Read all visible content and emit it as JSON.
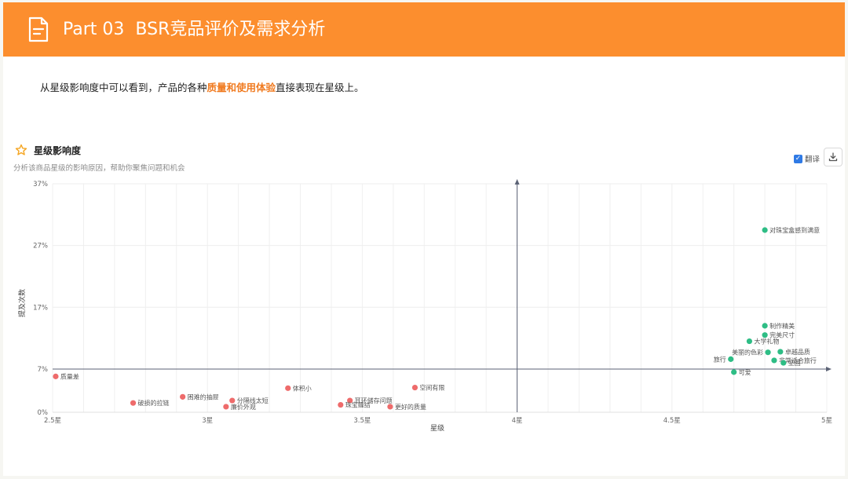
{
  "header": {
    "part": "Part 03",
    "title": "BSR竞品评价及需求分析",
    "icon": "document-icon"
  },
  "intro": {
    "before": "从星级影响度中可以看到，产品的各种",
    "highlight": "质量和使用体验",
    "after": "直接表现在星级上。"
  },
  "card": {
    "title": "星级影响度",
    "subtitle": "分析该商品星级的影响原因，帮助你聚焦问题和机会",
    "translate_label": "翻译",
    "translate_checked": true
  },
  "colors": {
    "header_bg": "#fc8e2e",
    "highlight": "#f07a1f",
    "positive": "#2ebd85",
    "negative": "#ee6b6b"
  },
  "chart_data": {
    "type": "scatter",
    "title": "",
    "xlabel": "星级",
    "ylabel": "提及次数",
    "xlim": [
      2.5,
      5
    ],
    "ylim": [
      0,
      37
    ],
    "x_ticks": [
      2.5,
      3,
      3.5,
      4,
      4.5,
      5
    ],
    "x_tick_labels": [
      "2.5星",
      "3星",
      "3.5星",
      "4星",
      "4.5星",
      "5星"
    ],
    "y_ticks": [
      0,
      7,
      17,
      27,
      37
    ],
    "y_tick_labels": [
      "0%",
      "7%",
      "17%",
      "27%",
      "37%"
    ],
    "quadrant_axes": {
      "x": 4.0,
      "y": 7
    },
    "grid": true,
    "points": [
      {
        "label": "对珠宝盒感到满意",
        "x": 4.8,
        "y": 29.5,
        "sentiment": "positive"
      },
      {
        "label": "制作精美",
        "x": 4.8,
        "y": 14.0,
        "sentiment": "positive"
      },
      {
        "label": "完美尺寸",
        "x": 4.8,
        "y": 12.5,
        "sentiment": "positive"
      },
      {
        "label": "大学礼物",
        "x": 4.75,
        "y": 11.5,
        "sentiment": "positive"
      },
      {
        "label": "美丽的色彩",
        "x": 4.81,
        "y": 9.7,
        "sentiment": "positive"
      },
      {
        "label": "卓越品质",
        "x": 4.85,
        "y": 9.8,
        "sentiment": "positive"
      },
      {
        "label": "旅行",
        "x": 4.69,
        "y": 8.6,
        "sentiment": "positive"
      },
      {
        "label": "非常适合旅行",
        "x": 4.83,
        "y": 8.4,
        "sentiment": "positive"
      },
      {
        "label": "坚固",
        "x": 4.86,
        "y": 8.0,
        "sentiment": "positive"
      },
      {
        "label": "可爱",
        "x": 4.7,
        "y": 6.5,
        "sentiment": "positive"
      },
      {
        "label": "质量差",
        "x": 2.51,
        "y": 5.8,
        "sentiment": "negative"
      },
      {
        "label": "破损的拉链",
        "x": 2.76,
        "y": 1.5,
        "sentiment": "negative"
      },
      {
        "label": "困难的抽屉",
        "x": 2.92,
        "y": 2.5,
        "sentiment": "negative"
      },
      {
        "label": "分隔线太短",
        "x": 3.08,
        "y": 1.9,
        "sentiment": "negative"
      },
      {
        "label": "廉价外观",
        "x": 3.06,
        "y": 0.9,
        "sentiment": "negative"
      },
      {
        "label": "体积小",
        "x": 3.26,
        "y": 3.9,
        "sentiment": "negative"
      },
      {
        "label": "耳环储存问题",
        "x": 3.46,
        "y": 1.9,
        "sentiment": "negative"
      },
      {
        "label": "珠宝缠结",
        "x": 3.43,
        "y": 1.2,
        "sentiment": "negative"
      },
      {
        "label": "空间有限",
        "x": 3.67,
        "y": 4.0,
        "sentiment": "negative"
      },
      {
        "label": "更好的质量",
        "x": 3.59,
        "y": 0.9,
        "sentiment": "negative"
      }
    ]
  }
}
